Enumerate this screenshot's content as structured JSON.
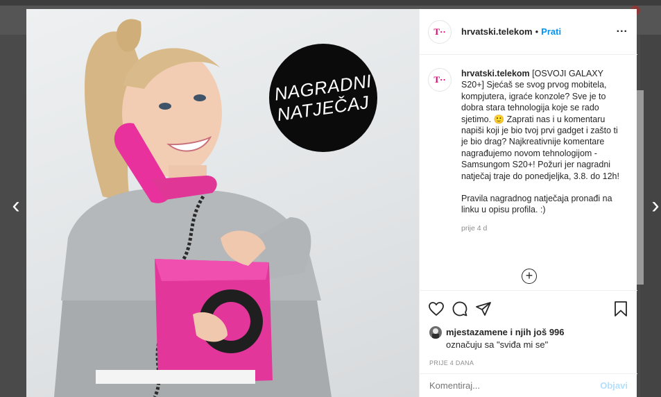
{
  "account": {
    "handle": "hrvatski.telekom",
    "separator": "•",
    "follow_label": "Prati",
    "more_label": "...",
    "logo_text": "T··",
    "brand_color": "#e20074"
  },
  "photo": {
    "badge_line1": "NAGRADNI",
    "badge_line2": "NATJEČAJ"
  },
  "caption": {
    "handle": "hrvatski.telekom",
    "text_part1": "[OSVOJI GALAXY S20+] Sjećaš se svog prvog mobitela, kompjutera, igraće konzole? Sve je to dobra stara tehnologija koje se rado sjetimo. 🙂 Zaprati nas i u komentaru napiši koji je bio tvoj prvi gadget i zašto ti je bio drag? Najkreativnije komentare nagrađujemo novom tehnologijom - Samsungom S20+! Požuri jer nagradni natječaj traje do ponedjeljka, 3.8. do 12h!",
    "text_part2": "Pravila nagradnog natječaja pronađi na linku u opisu profila. :)",
    "age": "prije 4 d",
    "load_more_symbol": "+"
  },
  "actions": {
    "like_icon": "heart-icon",
    "comment_icon": "comment-icon",
    "share_icon": "share-icon",
    "save_icon": "bookmark-icon"
  },
  "likes": {
    "line1": "mjestazamene i njih još 996",
    "line2": "označuju sa \"sviđa mi se\""
  },
  "date_label": "PRIJE 4 DANA",
  "comment": {
    "placeholder": "Komentiraj...",
    "post_label": "Objavi",
    "post_color": "#b2dffc"
  },
  "nav": {
    "prev_symbol": "‹",
    "next_symbol": "›"
  }
}
